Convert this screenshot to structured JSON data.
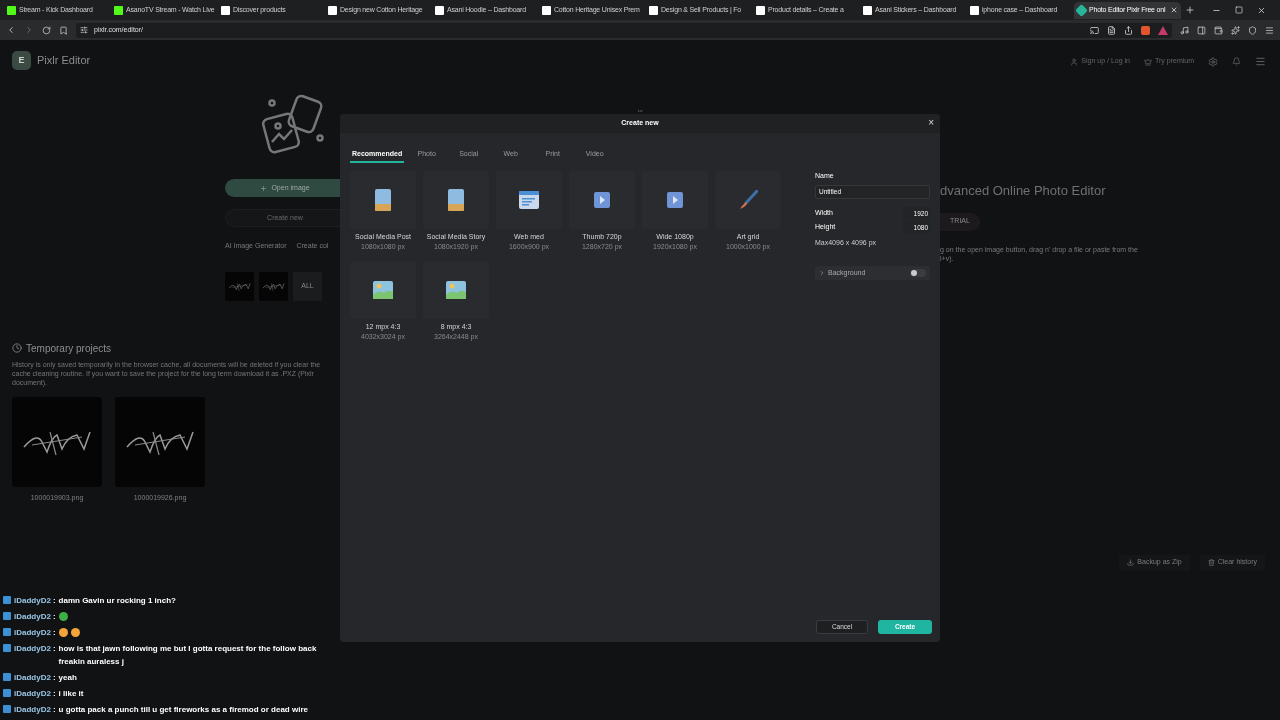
{
  "browser": {
    "tabs": [
      {
        "title": "Stream - Kick Dashboard",
        "kind": "kick",
        "selected": false
      },
      {
        "title": "AsanoTV Stream - Watch Live",
        "kind": "kick",
        "selected": false
      },
      {
        "title": "Discover products",
        "kind": "fw",
        "selected": false
      },
      {
        "title": "Design new Cotton Heritage",
        "kind": "fw",
        "selected": false
      },
      {
        "title": "Asani Hoodie – Dashboard",
        "kind": "fw",
        "selected": false
      },
      {
        "title": "Cotton Heritage Unisex Prem",
        "kind": "fw",
        "selected": false
      },
      {
        "title": "Design & Sell Products | Fo",
        "kind": "fw",
        "selected": false
      },
      {
        "title": "Product details – Create a",
        "kind": "fw",
        "selected": false
      },
      {
        "title": "Asani Stickers – Dashboard",
        "kind": "fw",
        "selected": false
      },
      {
        "title": "iphone case – Dashboard",
        "kind": "fw",
        "selected": false
      },
      {
        "title": "Photo Editor Pixlr Free onl",
        "kind": "pixlr",
        "selected": true
      }
    ],
    "url": "pixlr.com/editor/"
  },
  "app": {
    "logo": "E",
    "title": "Pixlr Editor",
    "sign_in": "Sign up / Log in",
    "premium": "Try premium"
  },
  "home": {
    "open_image": "Open image",
    "create_new": "Create new",
    "links": [
      "AI Image Generator",
      "Create col"
    ],
    "all": "ALL",
    "heading": "dvanced Online Photo Editor",
    "trial": "TRIAL",
    "hint_lines": [
      "g on the open image button, drag n' drop a file or paste from the",
      "l+v)."
    ],
    "temporary": {
      "title": "Temporary projects",
      "note": "History is only saved temporarily in the browser cache, all documents will be deleted if you clear the cache cleaning routine. If you want to save the project for the long term download it as .PXZ (Pixlr document).",
      "projects": [
        {
          "name": "1000019903.png"
        },
        {
          "name": "1000019926.png"
        }
      ]
    },
    "backup": "Backup as Zip",
    "clear": "Clear history"
  },
  "dialog": {
    "title": "Create new",
    "close": "×",
    "tabs": [
      {
        "label": "Recommended",
        "selected": true
      },
      {
        "label": "Photo",
        "selected": false
      },
      {
        "label": "Social",
        "selected": false
      },
      {
        "label": "Web",
        "selected": false
      },
      {
        "label": "Print",
        "selected": false
      },
      {
        "label": "Video",
        "selected": false
      }
    ],
    "presets": [
      {
        "name": "Social Media Post",
        "size": "1080x1080 px",
        "kind": "portrait"
      },
      {
        "name": "Social Media Story",
        "size": "1080x1920 px",
        "kind": "portrait"
      },
      {
        "name": "Web med",
        "size": "1600x900 px",
        "kind": "web"
      },
      {
        "name": "Thumb 720p",
        "size": "1280x720 px",
        "kind": "video"
      },
      {
        "name": "Wide 1080p",
        "size": "1920x1080 px",
        "kind": "video"
      },
      {
        "name": "Art grid",
        "size": "1000x1000 px",
        "kind": "brush"
      },
      {
        "name": "12 mpx 4:3",
        "size": "4032x3024 px",
        "kind": "landscape"
      },
      {
        "name": "8 mpx 4:3",
        "size": "3264x2448 px",
        "kind": "landscape"
      }
    ],
    "name_label": "Name",
    "name_value": "Untitled",
    "width_label": "Width",
    "width_value": "1920",
    "height_label": "Height",
    "height_value": "1080",
    "max_note": "Max4096 x 4096 px",
    "background": {
      "label": "Background",
      "on": false
    },
    "cancel": "Cancel",
    "create": "Create"
  },
  "chat": [
    {
      "user": "iDaddyD2",
      "sep": ":",
      "text": "damn Gavin ur rocking 1 inch?"
    },
    {
      "user": "iDaddyD2",
      "sep": ":",
      "emotes": [
        {
          "color": "#3cb043"
        }
      ]
    },
    {
      "user": "iDaddyD2",
      "sep": ":",
      "emotes": [
        {
          "color": "#f2a43a"
        },
        {
          "color": "#f2a43a"
        }
      ]
    },
    {
      "user": "iDaddyD2",
      "sep": ":",
      "text": "how is that jawn following me but I gotta request for the follow back freakin auraless j"
    },
    {
      "user": "iDaddyD2",
      "sep": ":",
      "text": "yeah"
    },
    {
      "user": "iDaddyD2",
      "sep": ":",
      "text": "i like it"
    },
    {
      "user": "iDaddyD2",
      "sep": ":",
      "text": "u gotta pack a punch till u get fireworks as a firemod or dead wire"
    }
  ]
}
